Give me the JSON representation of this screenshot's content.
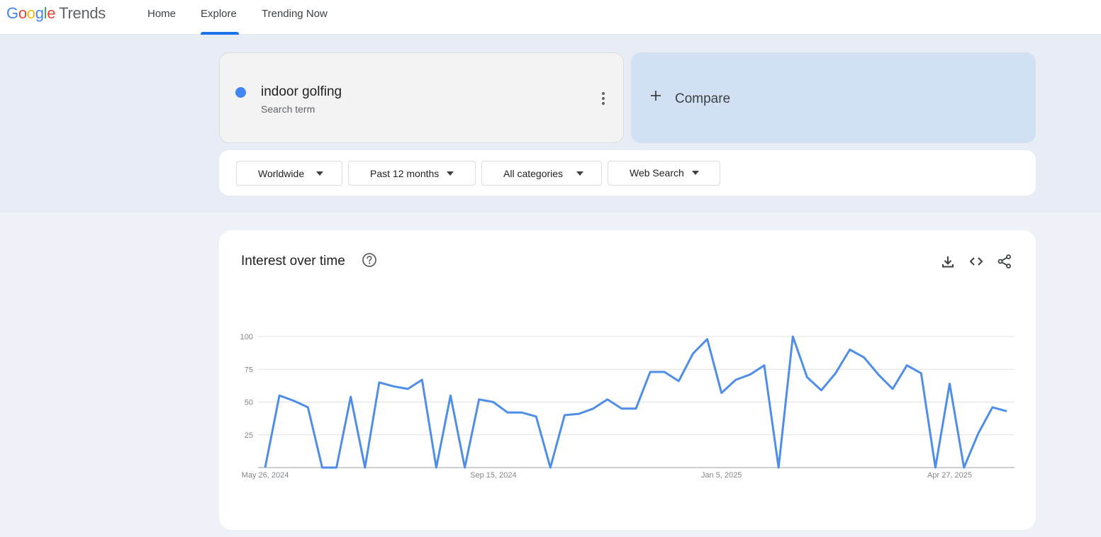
{
  "header": {
    "logo_google": [
      "G",
      "o",
      "o",
      "g",
      "l",
      "e"
    ],
    "logo_trends": "Trends",
    "nav": [
      {
        "label": "Home",
        "active": false
      },
      {
        "label": "Explore",
        "active": true
      },
      {
        "label": "Trending Now",
        "active": false
      }
    ],
    "accent_color": "#1a73e8"
  },
  "search_term": {
    "name": "indoor golfing",
    "type": "Search term",
    "color": "#4285f4",
    "menu_icon": "more-vert-icon"
  },
  "compare": {
    "icon": "plus-icon",
    "label": "Compare"
  },
  "filters": [
    {
      "label": "Worldwide",
      "icon": "caret-down-icon"
    },
    {
      "label": "Past 12 months",
      "icon": "caret-down-icon"
    },
    {
      "label": "All categories",
      "icon": "caret-down-icon"
    },
    {
      "label": "Web Search",
      "icon": "caret-down-icon"
    }
  ],
  "interest_panel": {
    "title": "Interest over time",
    "icons": [
      "help-icon",
      "download-icon",
      "embed-code-icon",
      "share-icon"
    ]
  },
  "chart_data": {
    "type": "line",
    "title": "",
    "xlabel": "",
    "ylabel": "",
    "ylim": [
      0,
      100
    ],
    "yticks": [
      25,
      50,
      75,
      100
    ],
    "x_tick_labels": [
      "May 26, 2024",
      "Sep 15, 2024",
      "Jan 5, 2025",
      "Apr 27, 2025"
    ],
    "x_tick_indices": [
      0,
      16,
      32,
      48
    ],
    "grid": true,
    "series": [
      {
        "color": "#4f8ee8",
        "values": [
          0,
          55,
          51,
          46,
          0,
          0,
          54,
          0,
          65,
          62,
          60,
          67,
          0,
          55,
          0,
          52,
          50,
          42,
          42,
          39,
          0,
          40,
          41,
          45,
          52,
          45,
          45,
          73,
          73,
          66,
          87,
          98,
          57,
          67,
          71,
          78,
          0,
          100,
          69,
          59,
          72,
          90,
          84,
          71,
          60,
          78,
          72,
          0,
          64,
          0,
          26,
          46,
          43
        ]
      }
    ]
  }
}
